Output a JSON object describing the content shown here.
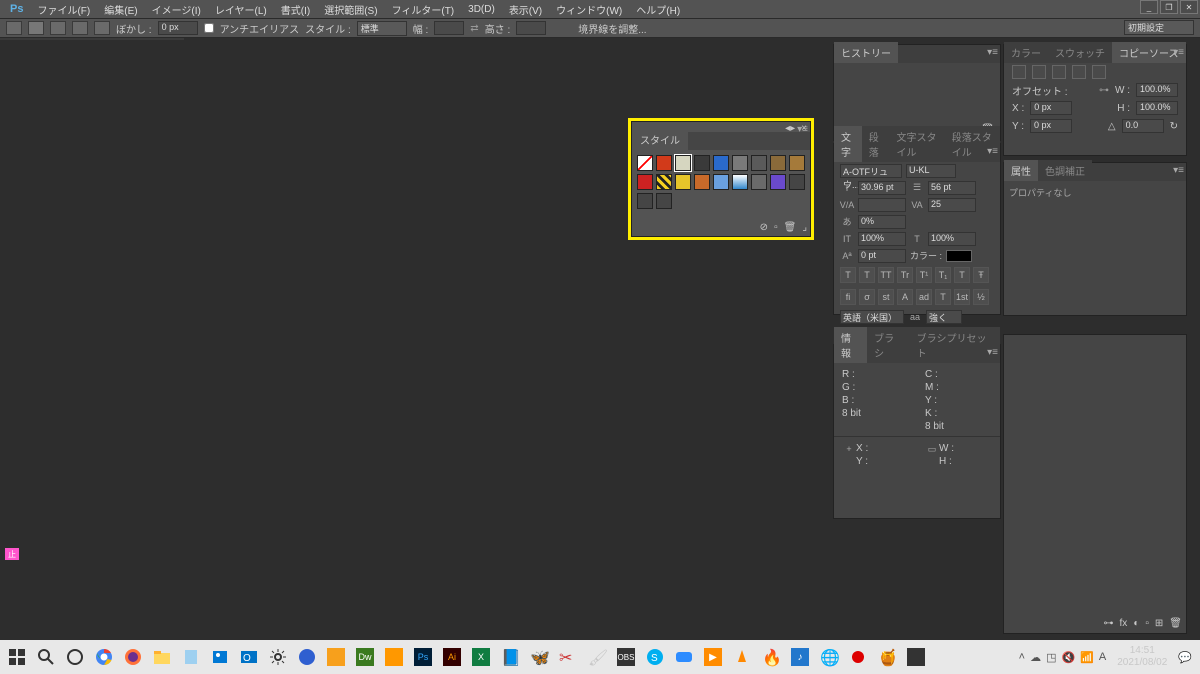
{
  "menu": {
    "items": [
      "ファイル(F)",
      "編集(E)",
      "イメージ(I)",
      "レイヤー(L)",
      "書式(I)",
      "選択範囲(S)",
      "フィルター(T)",
      "3D(D)",
      "表示(V)",
      "ウィンドウ(W)",
      "ヘルプ(H)"
    ]
  },
  "window_controls": {
    "min": "_",
    "max": "❐",
    "close": "✕"
  },
  "optbar": {
    "feather_lbl": "ぼかし :",
    "feather_val": "0 px",
    "antialias": "アンチエイリアス",
    "style_lbl": "スタイル :",
    "style_val": "標準",
    "width_lbl": "幅 :",
    "height_lbl": "高さ :",
    "refine": "境界線を調整...",
    "workspace": "初期設定"
  },
  "styles_panel": {
    "tab": "スタイル",
    "swatches": [
      {
        "c": "linear-gradient(135deg,#fff 45%,#f00 46%,#f00 54%,#fff 55%)",
        "sel": false
      },
      {
        "c": "#d23a1a",
        "sel": false
      },
      {
        "c": "#d6d6c0",
        "sel": true
      },
      {
        "c": "#3a3a3a",
        "sel": false
      },
      {
        "c": "#2a6acc",
        "sel": false
      },
      {
        "c": "#7a7a7a",
        "sel": false
      },
      {
        "c": "#5a5a5a",
        "sel": false
      },
      {
        "c": "#8a6a3a",
        "sel": false
      },
      {
        "c": "#a57a3a",
        "sel": false
      },
      {
        "c": "#c22",
        "sel": false
      },
      {
        "c": "repeating-linear-gradient(45deg,#f5d020 0 3px,#222 3px 6px)",
        "sel": false
      },
      {
        "c": "#e6c52a",
        "sel": false
      },
      {
        "c": "#c96a2a",
        "sel": false
      },
      {
        "c": "#6aa0e0",
        "sel": false
      },
      {
        "c": "linear-gradient(#fff,#38c)",
        "sel": false
      },
      {
        "c": "#6a6a6a",
        "sel": false
      },
      {
        "c": "#6a4acc",
        "sel": false
      },
      {
        "c": "#454545",
        "sel": false
      },
      {
        "c": "#454545",
        "sel": false
      },
      {
        "c": "#454545",
        "sel": false
      }
    ]
  },
  "history": {
    "tab": "ヒストリー"
  },
  "char": {
    "tabs": [
      "文字",
      "段落",
      "文字スタイル",
      "段落スタイル"
    ],
    "font": "A-OTFリュウ...",
    "weight": "U-KL",
    "size": "30.96 pt",
    "leading": "56 pt",
    "va_lbl": "V/A",
    "tracking": "25",
    "scale": "0%",
    "hscale": "100%",
    "vscale": "100%",
    "baseline": "0 pt",
    "color_lbl": "カラー :",
    "lang": "英語（米国）",
    "sharp": "強く",
    "tbtns": [
      "T",
      "T",
      "TT",
      "Tr",
      "T¹",
      "T₁",
      "T",
      "Ŧ"
    ],
    "obtns": [
      "fi",
      "σ",
      "st",
      "A",
      "ad",
      "T",
      "1st",
      "½"
    ]
  },
  "info": {
    "tabs": [
      "情報",
      "ブラシ",
      "ブラシプリセット"
    ],
    "r": "R :",
    "g": "G :",
    "b": "B :",
    "bit1": "8 bit",
    "c": "C :",
    "m": "M :",
    "y": "Y :",
    "k": "K :",
    "bit2": "8 bit",
    "x": "X :",
    "y2": "Y :",
    "w": "W :",
    "h": "H :"
  },
  "color": {
    "tabs": [
      "カラー",
      "スウォッチ",
      "コピーソース"
    ],
    "offset": "オフセット :",
    "w_lbl": "W :",
    "w_val": "100.0%",
    "x_lbl": "X :",
    "x_val": "0 px",
    "h_lbl": "H :",
    "h_val": "100.0%",
    "y_lbl": "Y :",
    "y_val": "0 px",
    "ang": "0.0"
  },
  "props": {
    "tabs": [
      "属性",
      "色調補正"
    ],
    "empty": "プロパティなし"
  },
  "taskbar": {
    "time": "14:51",
    "date": "2021/08/02"
  },
  "pink": "止"
}
